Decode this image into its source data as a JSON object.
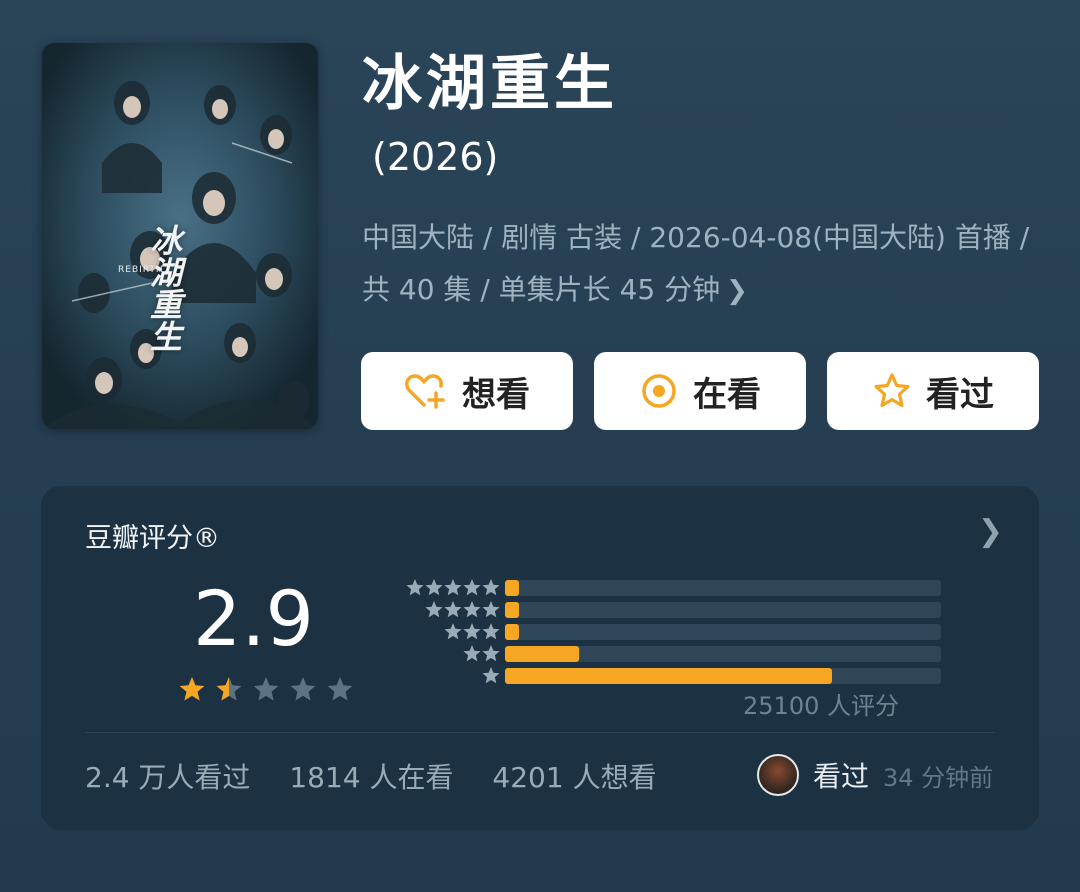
{
  "title": "冰湖重生",
  "year": "(2026)",
  "meta_text": "中国大陆 / 剧情 古装 / 2026-04-08(中国大陆) 首播 / 共 40 集 / 单集片长 45 分钟",
  "poster": {
    "calligraphy": "冰湖重生",
    "english": "REBIRTH"
  },
  "buttons": {
    "want_label": "想看",
    "watching_label": "在看",
    "watched_label": "看过"
  },
  "rating": {
    "header": "豆瓣评分®",
    "score": "2.9",
    "score_stars": 1.5,
    "distribution_fractions": [
      0.03,
      0.03,
      0.03,
      0.17,
      0.75
    ],
    "count_text": "25100 人评分"
  },
  "stats": {
    "watched": "2.4 万人看过",
    "watching": "1814 人在看",
    "wanting": "4201 人想看"
  },
  "recent": {
    "label": "看过",
    "time": "34 分钟前"
  },
  "colors": {
    "accent_orange": "#f5a623",
    "background": "#243c50",
    "card": "#1c3142",
    "bar_track": "#2e4658",
    "muted_star": "#5d7283"
  }
}
